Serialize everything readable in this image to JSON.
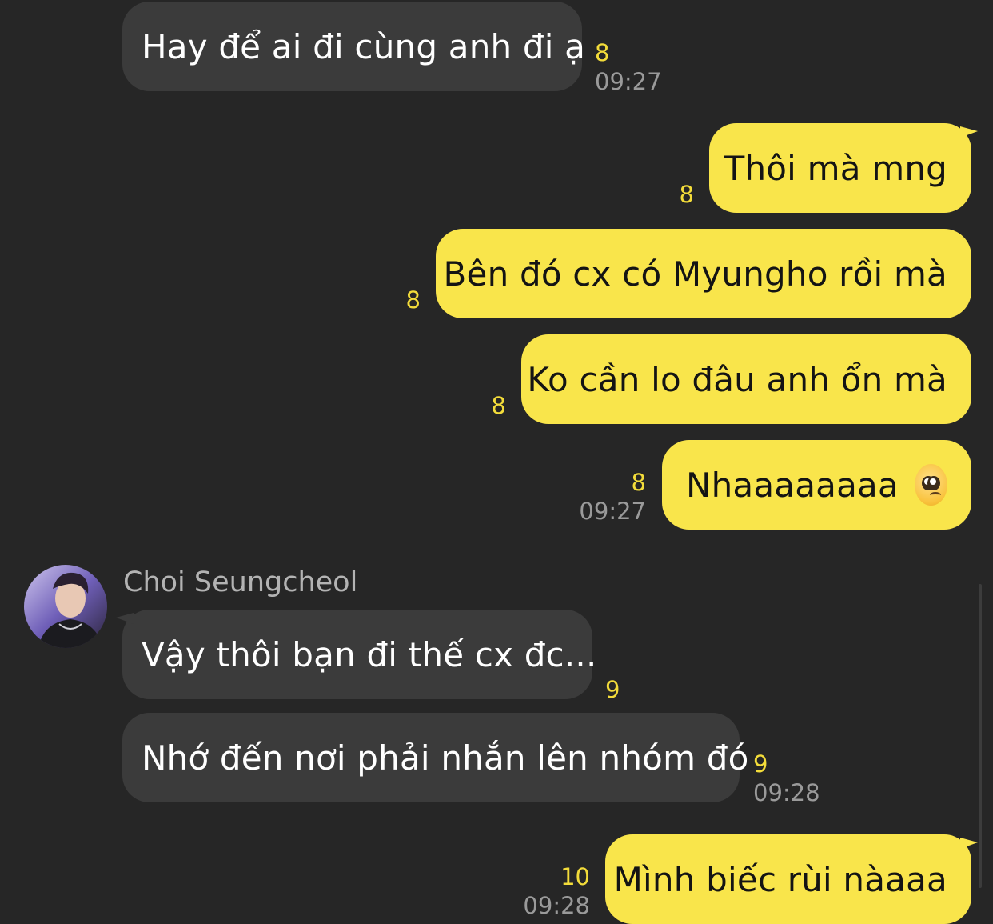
{
  "messages": [
    {
      "text": "Hay để ai đi cùng anh đi ạ",
      "count": "8",
      "time": "09:27"
    },
    {
      "text": "Thôi mà mng",
      "count": "8"
    },
    {
      "text": "Bên đó cx có Myungho rồi mà",
      "count": "8"
    },
    {
      "text": "Ko cần lo đâu anh ổn mà",
      "count": "8"
    },
    {
      "text": "Nhaaaaaaaa",
      "count": "8",
      "time": "09:27",
      "emoji": "pleading-face-icon"
    },
    {
      "text": "Vậy thôi bạn đi thế cx đc...",
      "count": "9"
    },
    {
      "text": "Nhớ đến nơi phải nhắn lên nhóm đó",
      "count": "9",
      "time": "09:28"
    },
    {
      "text": "Mình biếc rùi nàaaa",
      "count": "10",
      "time": "09:28"
    }
  ],
  "contact": {
    "name": "Choi Seungcheol"
  },
  "colors": {
    "background": "#262626",
    "incoming": "#3b3b3b",
    "outgoing": "#f9e54b",
    "unread": "#f3dc3a"
  }
}
